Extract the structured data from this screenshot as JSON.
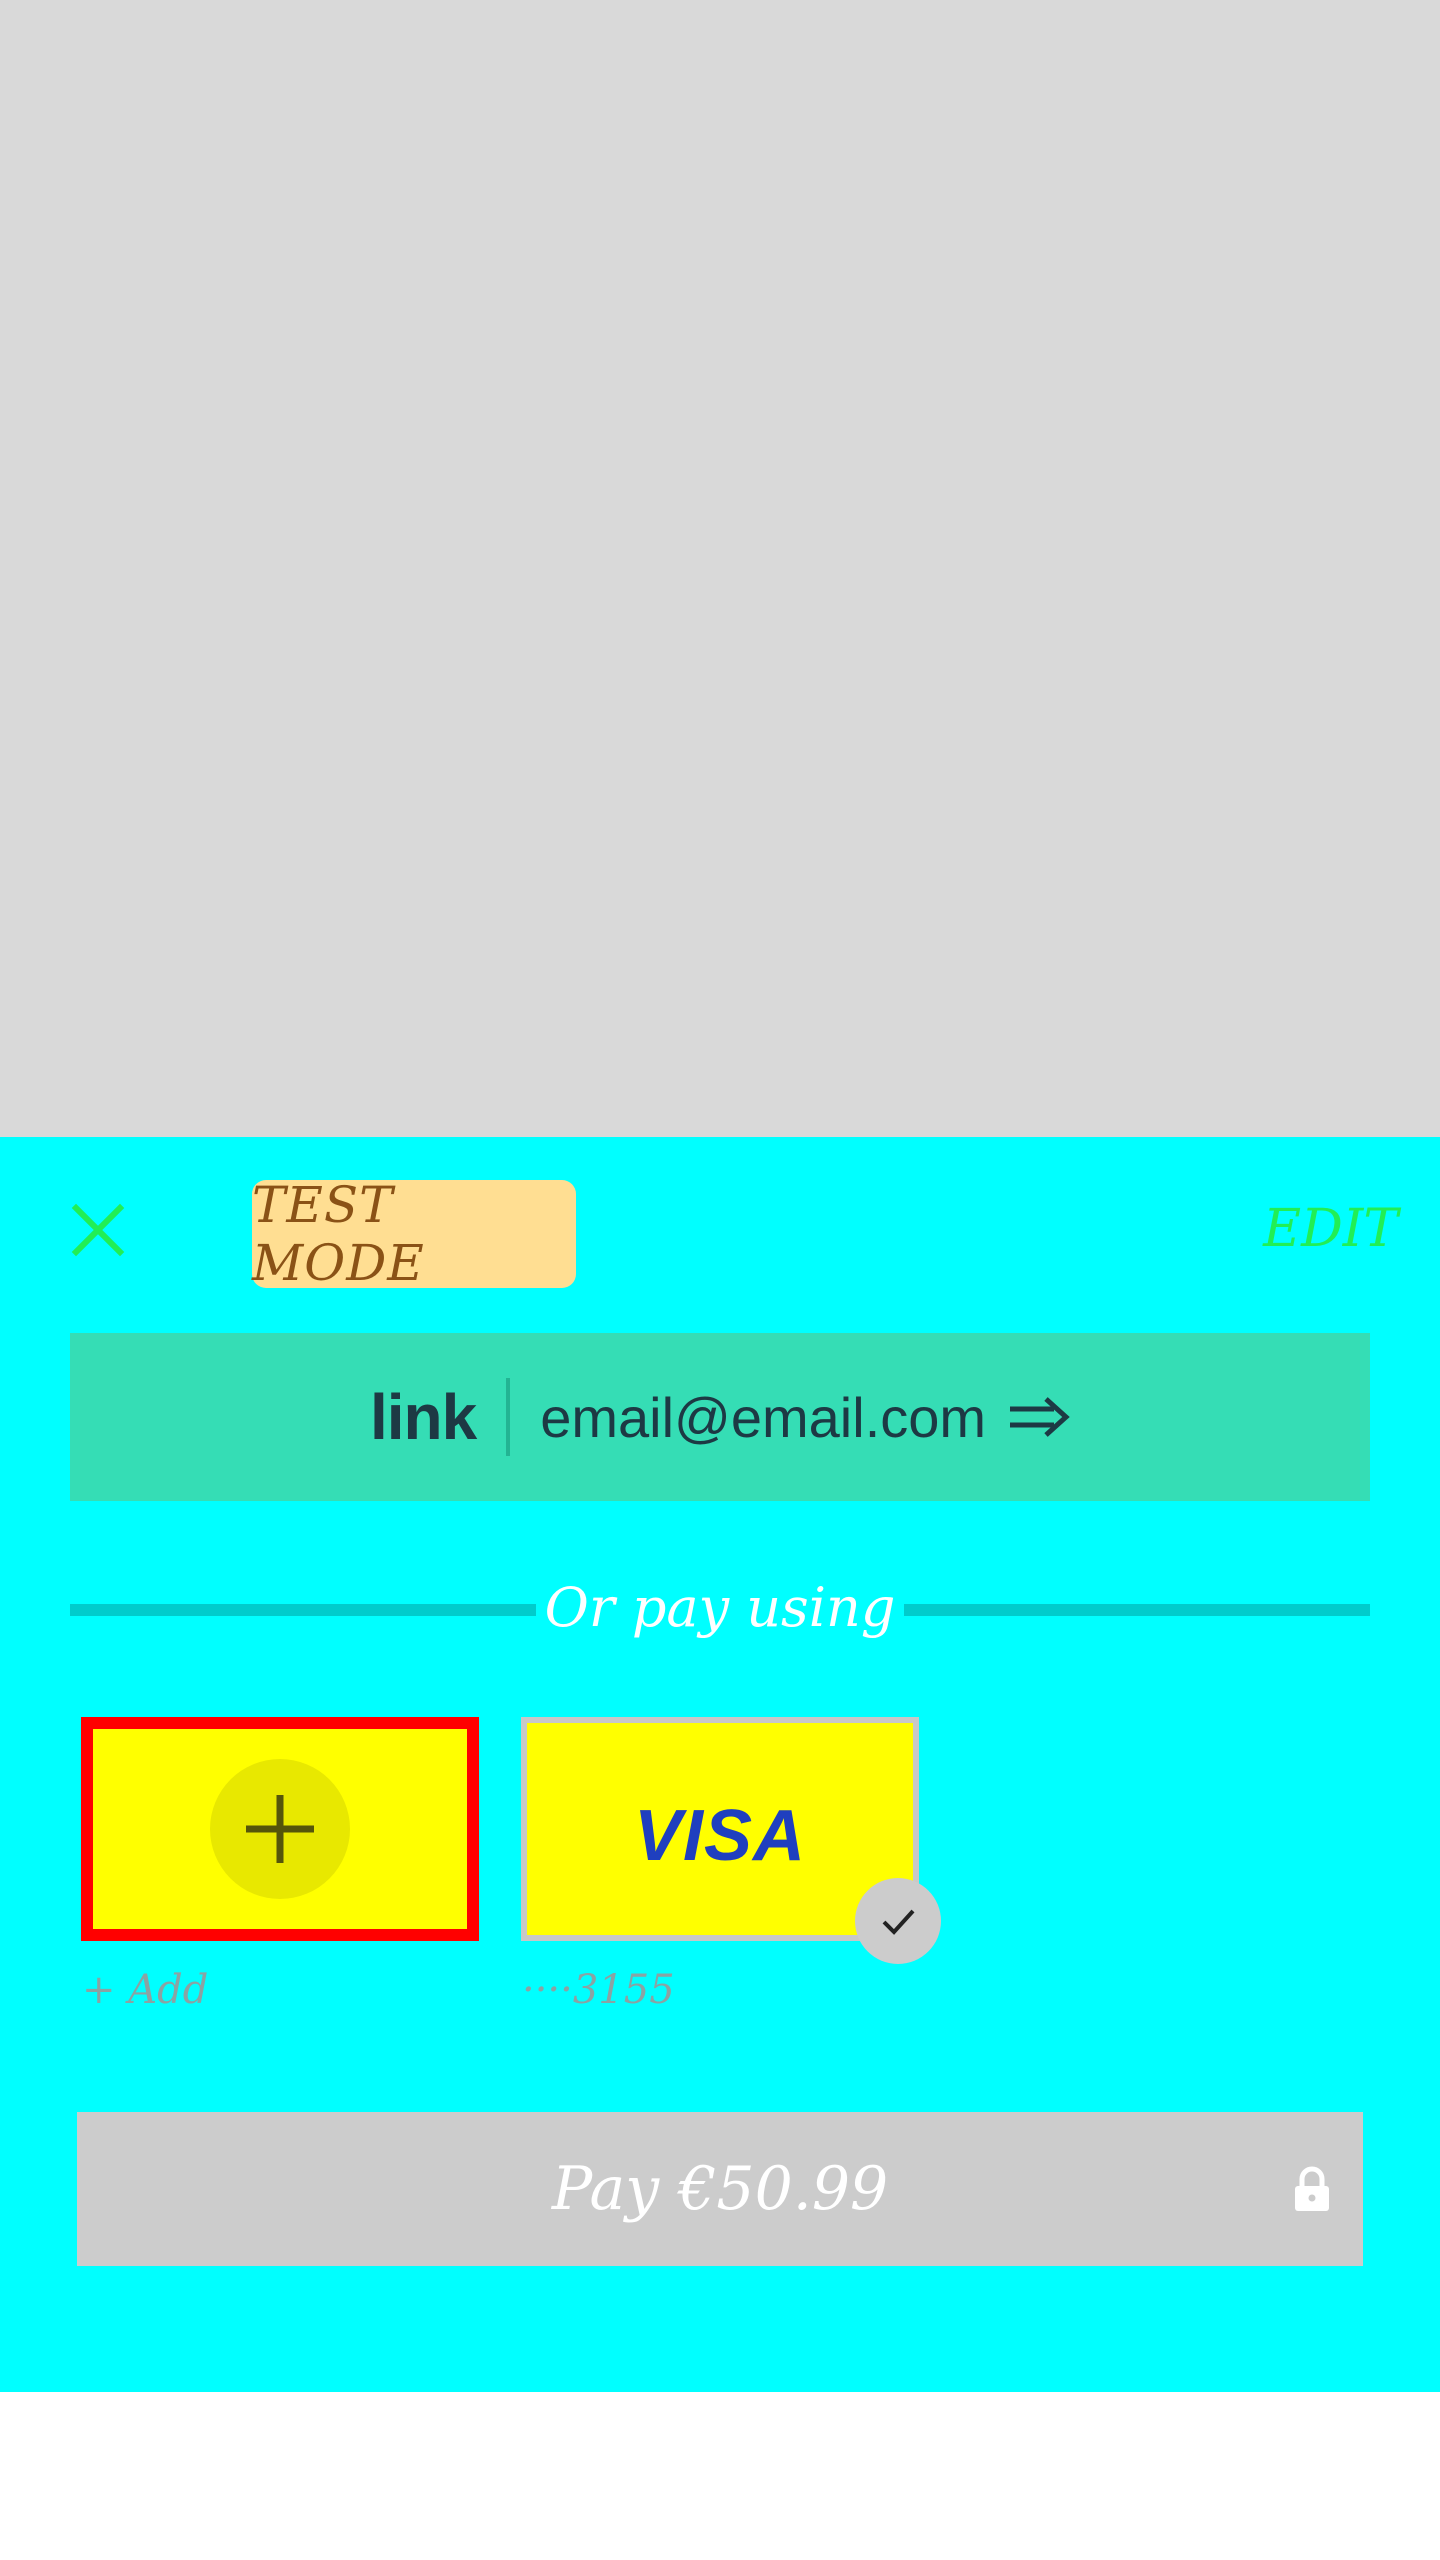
{
  "sheet": {
    "close_icon": "close-icon",
    "test_mode_label": "TEST MODE",
    "edit_label": "EDIT",
    "link": {
      "logo_text": "link",
      "email": "email@email.com",
      "arrow_icon": "arrow-right-icon"
    },
    "divider_text": "Or pay using",
    "payment_methods": [
      {
        "label": "+ Add",
        "icon": "plus-icon",
        "selected": false
      },
      {
        "label": "····3155",
        "brand": "VISA",
        "icon": "check-icon",
        "selected": true
      }
    ],
    "pay_button_label": "Pay €50.99",
    "lock_icon": "lock-icon"
  },
  "colors": {
    "sheet_background": "#00ffff",
    "backdrop": "#d9d9d9",
    "link_button": "#35ddb5",
    "test_badge": "#ffde92",
    "edit_text": "#22ee55",
    "tile_background": "#ffff00",
    "add_tile_border": "#ff0000",
    "pay_button": "#cccccc"
  }
}
